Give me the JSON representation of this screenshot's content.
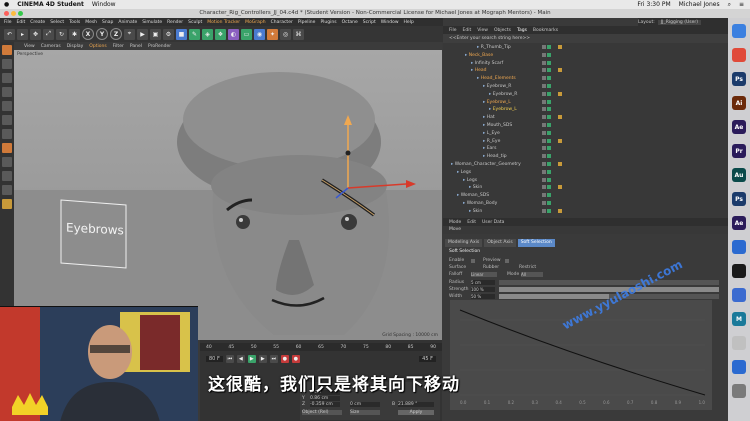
{
  "mac_menubar": {
    "app_name": "CINEMA 4D Student",
    "window_menu": "Window",
    "clock": "Fri 3:30 PM",
    "user": "Michael Jones"
  },
  "window": {
    "title": "Character_Rig_Controllers_JJ_04.c4d * (Student Version - Non-Commercial License for Michael Jones at Mograph Mentors) - Main",
    "layout_label": "Layout:",
    "layout_value": "JJ_Rigging (User)"
  },
  "main_menu": [
    "File",
    "Edit",
    "Create",
    "Select",
    "Tools",
    "Mesh",
    "Snap",
    "Animate",
    "Simulate",
    "Render",
    "Sculpt",
    "Motion Tracker",
    "MoGraph",
    "Character",
    "Pipeline",
    "Plugins",
    "Octane",
    "Script",
    "Window",
    "Help"
  ],
  "toolbar_axes": [
    "X",
    "Y",
    "Z"
  ],
  "viewport": {
    "menu": [
      "View",
      "Cameras",
      "Display",
      "Options",
      "Filter",
      "Panel",
      "ProRender"
    ],
    "label": "Perspective",
    "grid_spacing": "Grid Spacing : 10000 cm",
    "sign_text": "Eyebrows"
  },
  "timeline": {
    "ticks": [
      "40",
      "45",
      "50",
      "55",
      "60",
      "65",
      "70",
      "75",
      "80",
      "85",
      "90"
    ],
    "current_frame": "80 F",
    "end_frame": "90 F",
    "end_frame_right": "45 F"
  },
  "coordinates": {
    "labels": [
      "X",
      "Y",
      "Z"
    ],
    "values": [
      "0 cm",
      "0.86 cm",
      "-0.359 cm"
    ],
    "size_values": [
      "0 cm",
      "0 cm",
      "0 cm"
    ],
    "rot_labels": [
      "H",
      "P",
      "B"
    ],
    "rot_values": [
      "0 °",
      "0 °",
      "21.889 °"
    ],
    "mode_select": "Object (Rel)",
    "size_select": "Size",
    "apply_label": "Apply"
  },
  "object_manager": {
    "menu": [
      "File",
      "Edit",
      "View",
      "Objects",
      "Tags",
      "Bookmarks"
    ],
    "search_placeholder": "<<Enter your search string here>>",
    "objects": [
      {
        "name": "R_Thumb_Tip",
        "indent": 30,
        "style": "normal"
      },
      {
        "name": "Neck_Base",
        "indent": 18,
        "style": "orange"
      },
      {
        "name": "Infinity Scarf",
        "indent": 24,
        "style": "normal"
      },
      {
        "name": "Head",
        "indent": 24,
        "style": "orange"
      },
      {
        "name": "Head_Elements",
        "indent": 30,
        "style": "orange"
      },
      {
        "name": "Eyebrow_R",
        "indent": 36,
        "style": "normal"
      },
      {
        "name": "Eyebrow_R",
        "indent": 42,
        "style": "normal"
      },
      {
        "name": "Eyebrow_L",
        "indent": 36,
        "style": "orange"
      },
      {
        "name": "Eyebrow_L",
        "indent": 42,
        "style": "sel"
      },
      {
        "name": "Hat",
        "indent": 36,
        "style": "normal"
      },
      {
        "name": "Mouth_SDS",
        "indent": 36,
        "style": "normal"
      },
      {
        "name": "L_Eye",
        "indent": 36,
        "style": "normal"
      },
      {
        "name": "R_Eye",
        "indent": 36,
        "style": "normal"
      },
      {
        "name": "Ears",
        "indent": 36,
        "style": "normal"
      },
      {
        "name": "Head_tip",
        "indent": 36,
        "style": "normal"
      },
      {
        "name": "Woman_Character_Geometry",
        "indent": 4,
        "style": "normal"
      },
      {
        "name": "Legs",
        "indent": 10,
        "style": "normal"
      },
      {
        "name": "Legs",
        "indent": 16,
        "style": "normal"
      },
      {
        "name": "Skin",
        "indent": 22,
        "style": "normal"
      },
      {
        "name": "Woman_SDS",
        "indent": 10,
        "style": "normal"
      },
      {
        "name": "Woman_Body",
        "indent": 16,
        "style": "normal"
      },
      {
        "name": "Skin",
        "indent": 22,
        "style": "normal"
      }
    ]
  },
  "attributes": {
    "menu": [
      "Mode",
      "Edit",
      "User Data"
    ],
    "mode_title": "Move",
    "tabs": [
      "Modeling Axis",
      "Object Axis",
      "Soft Selection"
    ],
    "active_tab": "Soft Selection",
    "section_title": "Soft Selection",
    "rows": [
      {
        "label": "Enable",
        "value": ""
      },
      {
        "label": "Surface",
        "value": "Rubber"
      },
      {
        "label": "Falloff",
        "value": "Linear"
      },
      {
        "label": "Radius",
        "value": "5 cm"
      },
      {
        "label": "Strength",
        "value": "100 %"
      },
      {
        "label": "Width",
        "value": "50 %"
      }
    ],
    "extra_labels": [
      "Preview",
      "Restrict",
      "Mode"
    ],
    "mode_value": "All",
    "graph_x_ticks": [
      "0.0",
      "0.1",
      "0.2",
      "0.3",
      "0.4",
      "0.5",
      "0.6",
      "0.7",
      "0.8",
      "0.9",
      "1.0"
    ]
  },
  "dock_apps": [
    {
      "label": "",
      "color": "#3b80e0"
    },
    {
      "label": "",
      "color": "#e04a3a"
    },
    {
      "label": "Ps",
      "color": "#1b3b6b"
    },
    {
      "label": "Ai",
      "color": "#6b2a0a"
    },
    {
      "label": "Ae",
      "color": "#2a1b5a"
    },
    {
      "label": "Pr",
      "color": "#2a1b5a"
    },
    {
      "label": "Au",
      "color": "#0a4a4a"
    },
    {
      "label": "Ps",
      "color": "#1b3b6b"
    },
    {
      "label": "Ae",
      "color": "#2a1b5a"
    },
    {
      "label": "",
      "color": "#2a6ad0"
    },
    {
      "label": "",
      "color": "#1a1a1a"
    },
    {
      "label": "",
      "color": "#3b6bd0"
    },
    {
      "label": "M",
      "color": "#1a7a9a"
    },
    {
      "label": "",
      "color": "#c0c0c0"
    },
    {
      "label": "",
      "color": "#2a6ad0"
    },
    {
      "label": "",
      "color": "#7a7a7a"
    }
  ],
  "subtitle": "这很酷，我们只是将其向下移动",
  "watermark": "www.yyulaoshi.com",
  "colors": {
    "accent_orange": "#f0a850",
    "selection_blue": "#5b89c8",
    "viewport_bg": "#9c9c9c"
  }
}
